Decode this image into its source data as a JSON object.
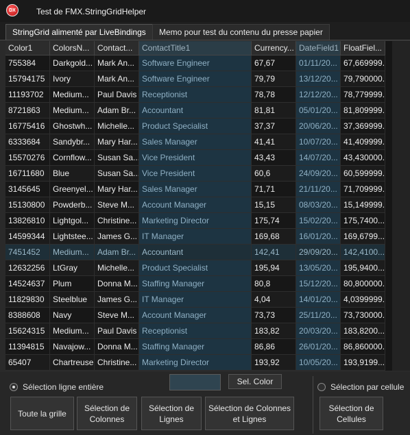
{
  "window": {
    "icon_text": "DX",
    "title": "Test de FMX.StringGridHelper"
  },
  "tabs": [
    {
      "label": "StringGrid alimenté par LiveBindings"
    },
    {
      "label": "Memo pour test du contenu du presse papier"
    }
  ],
  "grid": {
    "columns": [
      "Color1",
      "ColorsN...",
      "Contact...",
      "ContactTitle1",
      "Currency...",
      "DateField1",
      "FloatFiel..."
    ],
    "selected_columns": [
      3,
      5
    ],
    "selected_row": 12,
    "rows": [
      [
        "755384",
        "Darkgold...",
        "Mark An...",
        "Software Engineer",
        "67,67",
        "01/11/20...",
        "67,669999..."
      ],
      [
        "15794175",
        "Ivory",
        "Mark An...",
        "Software Engineer",
        "79,79",
        "13/12/20...",
        "79,790000..."
      ],
      [
        "11193702",
        "Medium...",
        "Paul Davis",
        "Receptionist",
        "78,78",
        "12/12/20...",
        "78,779999..."
      ],
      [
        "8721863",
        "Medium...",
        "Adam Br...",
        "Accountant",
        "81,81",
        "05/01/20...",
        "81,809999..."
      ],
      [
        "16775416",
        "Ghostwh...",
        "Michelle...",
        "Product Specialist",
        "37,37",
        "20/06/20...",
        "37,369999..."
      ],
      [
        "6333684",
        "Sandybr...",
        "Mary Har...",
        "Sales Manager",
        "41,41",
        "10/07/20...",
        "41,409999..."
      ],
      [
        "15570276",
        "Cornflow...",
        "Susan Sa...",
        "Vice President",
        "43,43",
        "14/07/20...",
        "43,430000..."
      ],
      [
        "16711680",
        "Blue",
        "Susan Sa...",
        "Vice President",
        "60,6",
        "24/09/20...",
        "60,599999..."
      ],
      [
        "3145645",
        "Greenyel...",
        "Mary Har...",
        "Sales Manager",
        "71,71",
        "21/11/20...",
        "71,709999..."
      ],
      [
        "15130800",
        "Powderb...",
        "Steve M...",
        "Account Manager",
        "15,15",
        "08/03/20...",
        "15,149999..."
      ],
      [
        "13826810",
        "Lightgol...",
        "Christine...",
        "Marketing Director",
        "175,74",
        "15/02/20...",
        "175,7400..."
      ],
      [
        "14599344",
        "Lightstee...",
        "James G...",
        "IT Manager",
        "169,68",
        "16/01/20...",
        "169,6799..."
      ],
      [
        "7451452",
        "Medium...",
        "Adam Br...",
        "Accountant",
        "142,41",
        "29/09/20...",
        "142,4100..."
      ],
      [
        "12632256",
        "LtGray",
        "Michelle...",
        "Product Specialist",
        "195,94",
        "13/05/20...",
        "195,9400..."
      ],
      [
        "14524637",
        "Plum",
        "Donna M...",
        "Staffing Manager",
        "80,8",
        "15/12/20...",
        "80,800000..."
      ],
      [
        "11829830",
        "Steelblue",
        "James G...",
        "IT Manager",
        "4,04",
        "14/01/20...",
        "4,0399999..."
      ],
      [
        "8388608",
        "Navy",
        "Steve M...",
        "Account Manager",
        "73,73",
        "25/11/20...",
        "73,730000..."
      ],
      [
        "15624315",
        "Medium...",
        "Paul Davis",
        "Receptionist",
        "183,82",
        "20/03/20...",
        "183,8200..."
      ],
      [
        "11394815",
        "Navajow...",
        "Donna M...",
        "Staffing Manager",
        "86,86",
        "26/01/20...",
        "86,860000..."
      ],
      [
        "65407",
        "Chartreuse",
        "Christine...",
        "Marketing Director",
        "193,92",
        "10/05/20...",
        "193,9199..."
      ]
    ]
  },
  "controls": {
    "radio_row": "Sélection ligne entière",
    "radio_cell": "Sélection par cellule",
    "color_swatch": "#2f4450",
    "sel_color_button": "Sel. Color",
    "btn_all": "Toute la grille",
    "btn_columns": "Sélection de\nColonnes",
    "btn_rows": "Sélection de\nLignes",
    "btn_cols_rows": "Sélection de Colonnes\net Lignes",
    "btn_cells": "Sélection de\nCellules"
  }
}
